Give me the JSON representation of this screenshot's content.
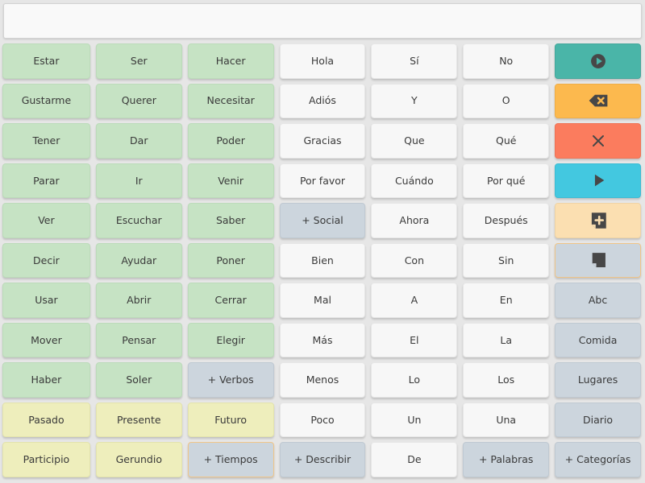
{
  "app": {
    "title": "Tablero de comunicación",
    "background_color": "#e6e6e6"
  },
  "message_bar": {
    "value": "",
    "placeholder": ""
  },
  "colors": {
    "verb": "#c6e3c4",
    "tense": "#eeeebc",
    "plain": "#f7f7f7",
    "category": "#ccd5dd",
    "speak": "#4ab5a8",
    "backspace": "#fcb94e",
    "clear": "#fb7c5e",
    "play": "#43c8e0",
    "add_note": "#fbdfb1",
    "highlight_border": "#f0c588"
  },
  "grid": {
    "columns": 7,
    "rows": 11,
    "cells": [
      {
        "label": "Estar",
        "type": "verb"
      },
      {
        "label": "Ser",
        "type": "verb"
      },
      {
        "label": "Hacer",
        "type": "verb"
      },
      {
        "label": "Hola",
        "type": "plain"
      },
      {
        "label": "Sí",
        "type": "plain"
      },
      {
        "label": "No",
        "type": "plain"
      },
      {
        "label": "",
        "type": "speak",
        "icon": "play-circle-icon"
      },
      {
        "label": "Gustarme",
        "type": "verb"
      },
      {
        "label": "Querer",
        "type": "verb"
      },
      {
        "label": "Necesitar",
        "type": "verb"
      },
      {
        "label": "Adiós",
        "type": "plain"
      },
      {
        "label": "Y",
        "type": "plain"
      },
      {
        "label": "O",
        "type": "plain"
      },
      {
        "label": "",
        "type": "backspace",
        "icon": "backspace-icon"
      },
      {
        "label": "Tener",
        "type": "verb"
      },
      {
        "label": "Dar",
        "type": "verb"
      },
      {
        "label": "Poder",
        "type": "verb"
      },
      {
        "label": "Gracias",
        "type": "plain"
      },
      {
        "label": "Que",
        "type": "plain"
      },
      {
        "label": "Qué",
        "type": "plain"
      },
      {
        "label": "",
        "type": "clear",
        "icon": "close-x-icon"
      },
      {
        "label": "Parar",
        "type": "verb"
      },
      {
        "label": "Ir",
        "type": "verb"
      },
      {
        "label": "Venir",
        "type": "verb"
      },
      {
        "label": "Por favor",
        "type": "plain"
      },
      {
        "label": "Cuándo",
        "type": "plain"
      },
      {
        "label": "Por qué",
        "type": "plain"
      },
      {
        "label": "",
        "type": "play",
        "icon": "play-triangle-icon"
      },
      {
        "label": "Ver",
        "type": "verb"
      },
      {
        "label": "Escuchar",
        "type": "verb"
      },
      {
        "label": "Saber",
        "type": "verb"
      },
      {
        "label": "+ Social",
        "type": "category"
      },
      {
        "label": "Ahora",
        "type": "plain"
      },
      {
        "label": "Después",
        "type": "plain"
      },
      {
        "label": "",
        "type": "add_note",
        "icon": "add-note-icon"
      },
      {
        "label": "Decir",
        "type": "verb"
      },
      {
        "label": "Ayudar",
        "type": "verb"
      },
      {
        "label": "Poner",
        "type": "verb"
      },
      {
        "label": "Bien",
        "type": "plain"
      },
      {
        "label": "Con",
        "type": "plain"
      },
      {
        "label": "Sin",
        "type": "plain"
      },
      {
        "label": "",
        "type": "category_highlight",
        "icon": "note-icon"
      },
      {
        "label": "Usar",
        "type": "verb"
      },
      {
        "label": "Abrir",
        "type": "verb"
      },
      {
        "label": "Cerrar",
        "type": "verb"
      },
      {
        "label": "Mal",
        "type": "plain"
      },
      {
        "label": "A",
        "type": "plain"
      },
      {
        "label": "En",
        "type": "plain"
      },
      {
        "label": "Abc",
        "type": "category"
      },
      {
        "label": "Mover",
        "type": "verb"
      },
      {
        "label": "Pensar",
        "type": "verb"
      },
      {
        "label": "Elegir",
        "type": "verb"
      },
      {
        "label": "Más",
        "type": "plain"
      },
      {
        "label": "El",
        "type": "plain"
      },
      {
        "label": "La",
        "type": "plain"
      },
      {
        "label": "Comida",
        "type": "category"
      },
      {
        "label": "Haber",
        "type": "verb"
      },
      {
        "label": "Soler",
        "type": "verb"
      },
      {
        "label": "+ Verbos",
        "type": "category"
      },
      {
        "label": "Menos",
        "type": "plain"
      },
      {
        "label": "Lo",
        "type": "plain"
      },
      {
        "label": "Los",
        "type": "plain"
      },
      {
        "label": "Lugares",
        "type": "category"
      },
      {
        "label": "Pasado",
        "type": "tense"
      },
      {
        "label": "Presente",
        "type": "tense"
      },
      {
        "label": "Futuro",
        "type": "tense"
      },
      {
        "label": "Poco",
        "type": "plain"
      },
      {
        "label": "Un",
        "type": "plain"
      },
      {
        "label": "Una",
        "type": "plain"
      },
      {
        "label": "Diario",
        "type": "category"
      },
      {
        "label": "Participio",
        "type": "tense"
      },
      {
        "label": "Gerundio",
        "type": "tense"
      },
      {
        "label": "+ Tiempos",
        "type": "category_highlight"
      },
      {
        "label": "+ Describir",
        "type": "category"
      },
      {
        "label": "De",
        "type": "plain"
      },
      {
        "label": "+ Palabras",
        "type": "category"
      },
      {
        "label": "+ Categorías",
        "type": "category"
      }
    ]
  }
}
